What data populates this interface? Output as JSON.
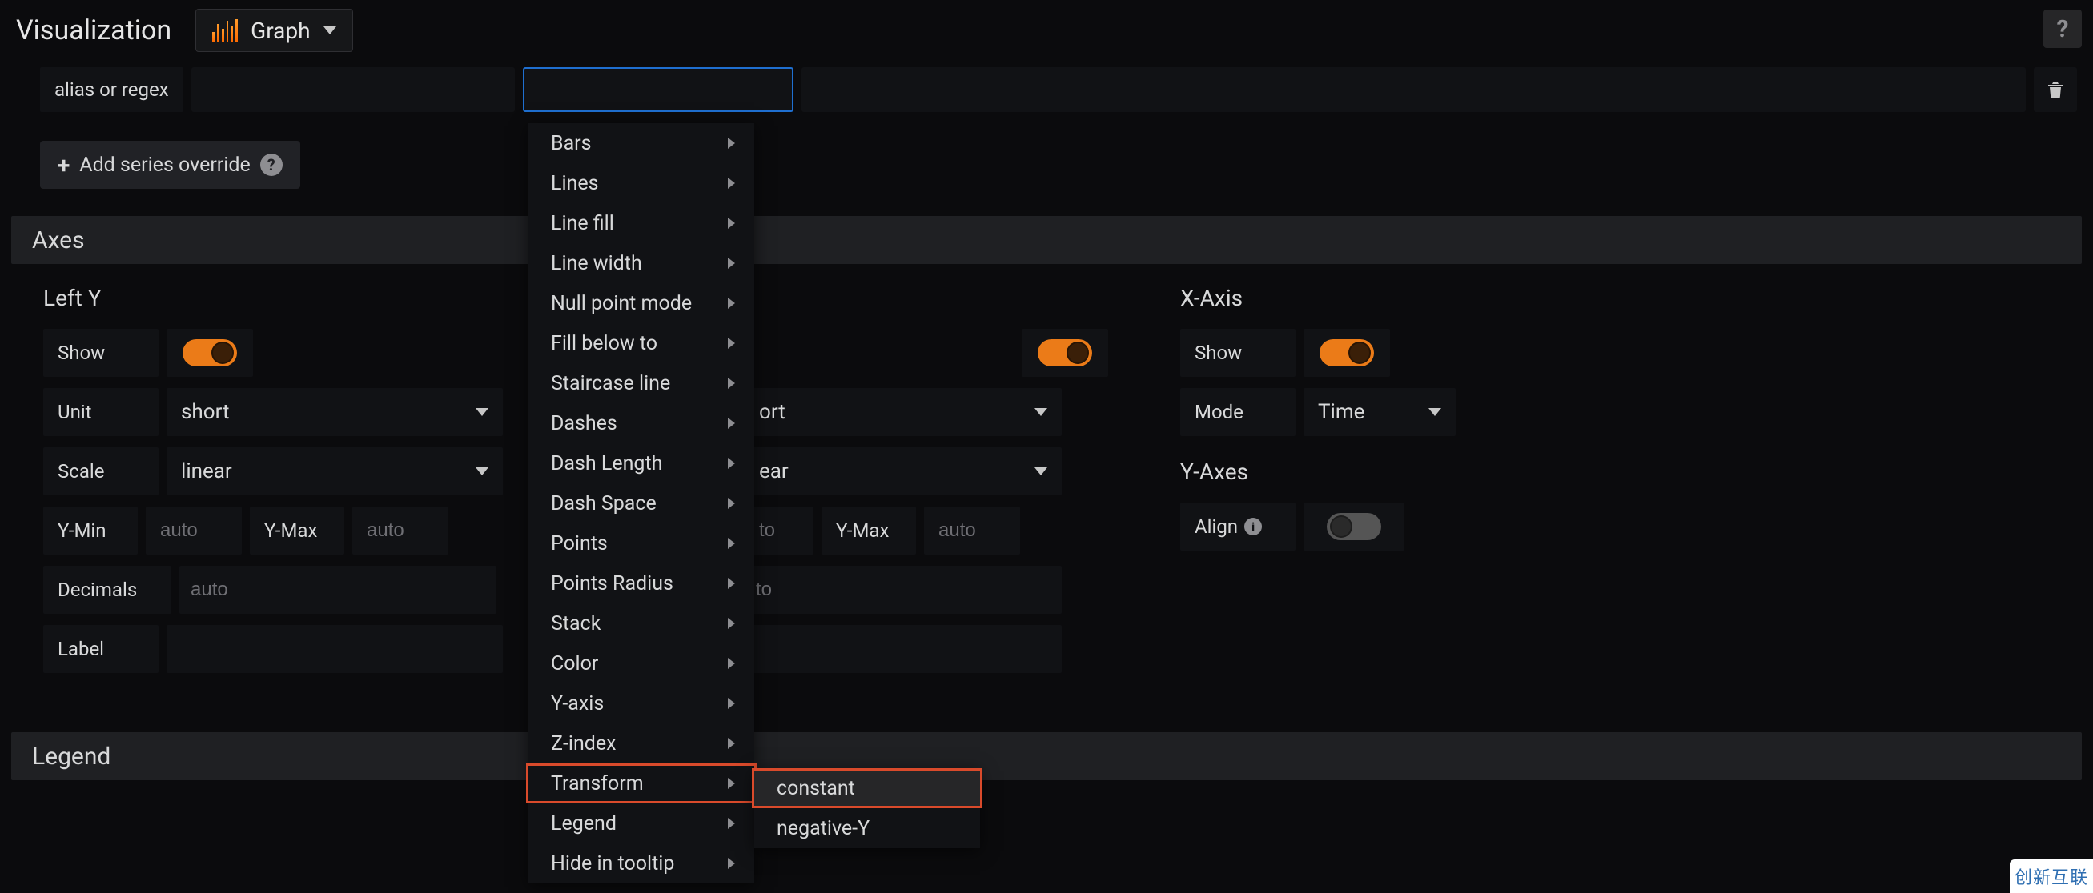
{
  "header": {
    "title": "Visualization",
    "viz_type": "Graph",
    "help": "?"
  },
  "override": {
    "alias_label": "alias or regex",
    "add_button": "Add series override"
  },
  "sections": {
    "axes": "Axes",
    "legend": "Legend"
  },
  "leftY": {
    "title": "Left Y",
    "show_label": "Show",
    "unit_label": "Unit",
    "unit_value": "short",
    "scale_label": "Scale",
    "scale_value": "linear",
    "ymin_label": "Y-Min",
    "ymin_placeholder": "auto",
    "ymax_label": "Y-Max",
    "ymax_placeholder": "auto",
    "decimals_label": "Decimals",
    "decimals_placeholder": "auto",
    "label_label": "Label"
  },
  "rightY": {
    "unit_value": "ort",
    "scale_value": "ear",
    "ymin_placeholder": "to",
    "ymax_label": "Y-Max",
    "ymax_placeholder": "auto",
    "decimals_placeholder": "to"
  },
  "xaxis": {
    "title": "X-Axis",
    "show_label": "Show",
    "mode_label": "Mode",
    "mode_value": "Time"
  },
  "yaxes": {
    "title": "Y-Axes",
    "align_label": "Align"
  },
  "menu": {
    "items": [
      "Bars",
      "Lines",
      "Line fill",
      "Line width",
      "Null point mode",
      "Fill below to",
      "Staircase line",
      "Dashes",
      "Dash Length",
      "Dash Space",
      "Points",
      "Points Radius",
      "Stack",
      "Color",
      "Y-axis",
      "Z-index",
      "Transform",
      "Legend",
      "Hide in tooltip"
    ],
    "highlight": "Transform"
  },
  "submenu": {
    "items": [
      "constant",
      "negative-Y"
    ],
    "highlight": "constant"
  },
  "badge": "创新互联"
}
